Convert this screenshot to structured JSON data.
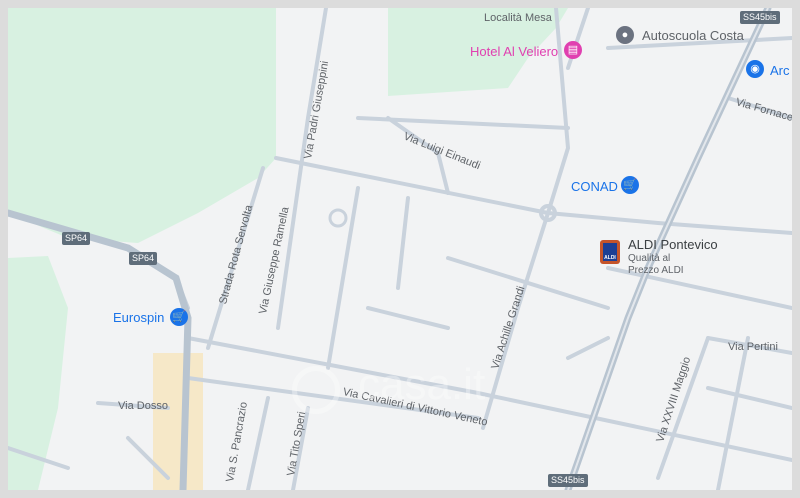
{
  "map": {
    "roads": {
      "localita_mesa": "Località Mesa",
      "via_padri_giuseppini": "Via Padri Giuseppini",
      "via_luigi_einaudi": "Via Luigi Einaudi",
      "strada_rota_servolta": "Strada Rota Servolta",
      "via_giuseppe_ramella": "Via Giuseppe Ramella",
      "via_achille_grandi": "Via Achille Grandi",
      "via_fornace": "Via Fornace",
      "via_pertini": "Via Pertini",
      "via_xxviii_maggio": "Via XXVIII Maggio",
      "via_dosso": "Via Dosso",
      "via_cavalieri": "Via Cavalieri di Vittorio Veneto",
      "via_s_pancrazio": "Via S. Pancrazio",
      "via_tito_speri": "Via Tito Speri"
    },
    "shields": {
      "sp64_a": "SP64",
      "sp64_b": "SP64",
      "ss45bis_top": "SS45bis",
      "ss45bis_bottom": "SS45bis"
    },
    "pois": {
      "hotel": "Hotel Al Veliero",
      "autoscuola": "Autoscuola Costa",
      "arc": "Arc",
      "conad": "CONAD",
      "aldi_name": "ALDI Pontevico",
      "aldi_sub1": "Qualità al",
      "aldi_sub2": "Prezzo ALDI",
      "aldi_logo_text": "ALDI",
      "eurospin": "Eurospin"
    },
    "watermark": "casa.it",
    "colors": {
      "background": "#f2f3f4",
      "green_area": "#d8f1e1",
      "road": "#c9d2dc",
      "highway": "#b8c4d0",
      "poi_blue": "#1a73e8",
      "hotel_pink": "#e040b0",
      "poi_gray": "#6b7280",
      "sand": "#f6e8c8"
    },
    "icons": {
      "hotel": "bed-icon",
      "autoscuola": "location-pin-icon",
      "arc": "lock-icon",
      "conad": "shopping-cart-icon",
      "eurospin": "shopping-cart-icon",
      "aldi": "aldi-logo-icon"
    }
  }
}
